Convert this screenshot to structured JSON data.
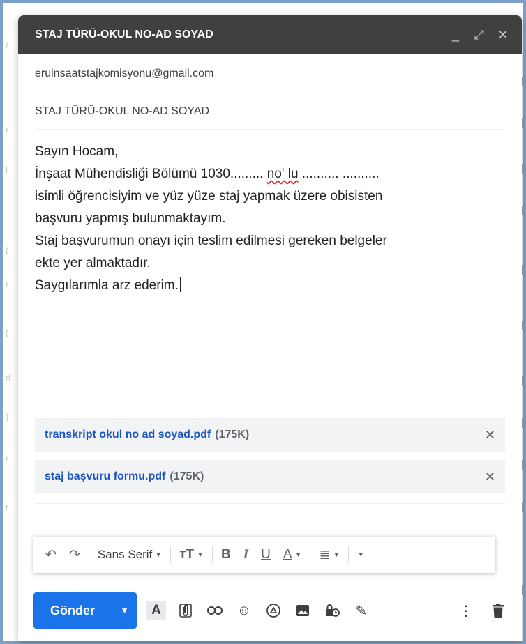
{
  "compose": {
    "title": "STAJ TÜRÜ-OKUL NO-AD SOYAD",
    "to": "eruinsaatstajkomisyonu@gmail.com",
    "subject": "STAJ TÜRÜ-OKUL NO-AD SOYAD",
    "body": {
      "line1": "Sayın Hocam,",
      "line2_a": "İnşaat Mühendisliği Bölümü 1030......... ",
      "line2_b": "no' lu",
      "line2_c": " .......... ..........",
      "line3": "isimli öğrencisiyim ve yüz yüze staj yapmak üzere obisisten",
      "line4": "başvuru yapmış bulunmaktayım.",
      "line5": "Staj başvurumun onayı için teslim edilmesi gereken belgeler",
      "line6": "ekte yer almaktadır.",
      "line7": "Saygılarımla arz ederim."
    },
    "attachments": [
      {
        "name": "transkript okul no ad soyad.pdf",
        "size": "(175K)"
      },
      {
        "name": "staj başvuru formu.pdf",
        "size": "(175K)"
      }
    ]
  },
  "window_buttons": {
    "minimize": "_",
    "expand": "⤢",
    "close": "✕"
  },
  "format_bar": {
    "font": "Sans Serif",
    "bold": "B",
    "italic": "I",
    "underline": "U",
    "text_color": "A"
  },
  "send": {
    "label": "Gönder"
  },
  "colors": {
    "titlebar": "#404040",
    "send": "#1a73e8",
    "attachment_link": "#1a56c2"
  }
}
